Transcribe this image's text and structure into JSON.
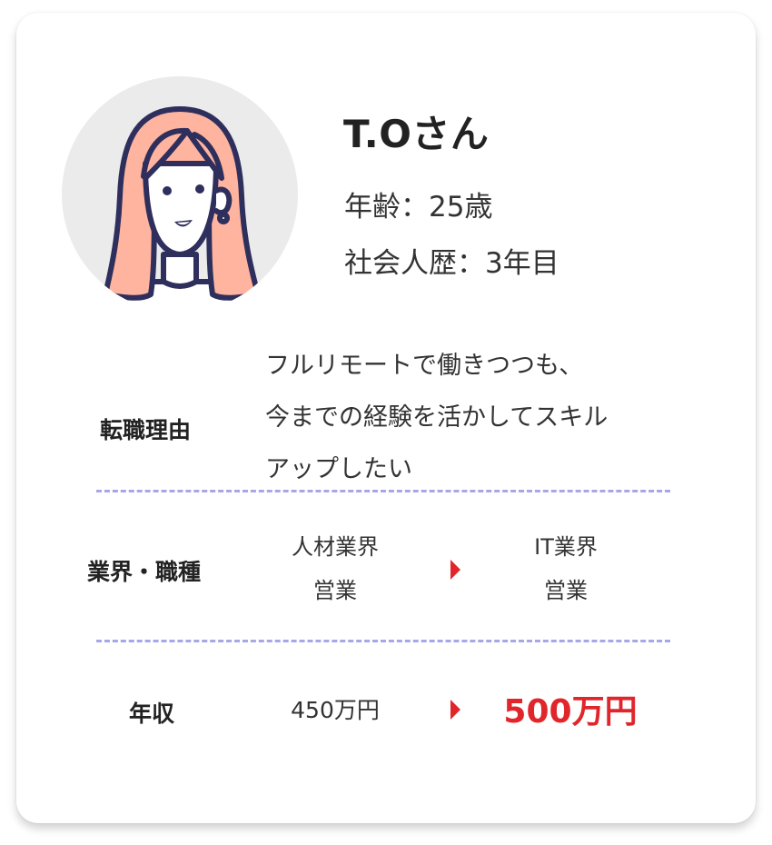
{
  "profile": {
    "name": "T.Oさん",
    "age": "年齢：25歳",
    "career": "社会人歴：3年目",
    "avatar_icon": "woman-avatar-icon"
  },
  "reason": {
    "label": "転職理由",
    "lines": [
      "フルリモートで働きつつも、",
      "今までの経験を活かしてスキル",
      "アップしたい"
    ]
  },
  "industry": {
    "label": "業界・職種",
    "from": [
      "人材業界",
      "営業"
    ],
    "to": [
      "IT業界",
      "営業"
    ]
  },
  "salary": {
    "label": "年収",
    "from": "450万円",
    "to": "500万円"
  },
  "colors": {
    "accent_red": "#e0262b",
    "divider": "#a9a6e8",
    "hair": "#ffb49f",
    "outline": "#2e2f5c",
    "avatar_bg": "#ebebeb"
  }
}
